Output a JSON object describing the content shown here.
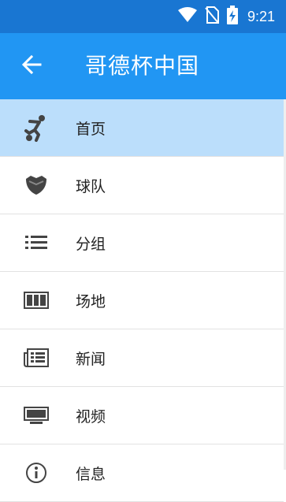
{
  "status_bar": {
    "time": "9:21",
    "icons": [
      "wifi-icon",
      "no-sim-icon",
      "battery-charging-icon"
    ]
  },
  "app_bar": {
    "title": "哥德杯中国",
    "back_icon": "arrow-back-icon"
  },
  "menu": {
    "items": [
      {
        "label": "首页",
        "icon": "soccer-player-icon",
        "active": true
      },
      {
        "label": "球队",
        "icon": "shield-icon",
        "active": false
      },
      {
        "label": "分组",
        "icon": "list-icon",
        "active": false
      },
      {
        "label": "场地",
        "icon": "field-icon",
        "active": false
      },
      {
        "label": "新闻",
        "icon": "newspaper-icon",
        "active": false
      },
      {
        "label": "视频",
        "icon": "monitor-icon",
        "active": false
      },
      {
        "label": "信息",
        "icon": "info-icon",
        "active": false
      }
    ]
  },
  "colors": {
    "status_bar": "#1976d2",
    "app_bar": "#2196f3",
    "active_item": "#bbdefb",
    "icon": "#444444"
  }
}
